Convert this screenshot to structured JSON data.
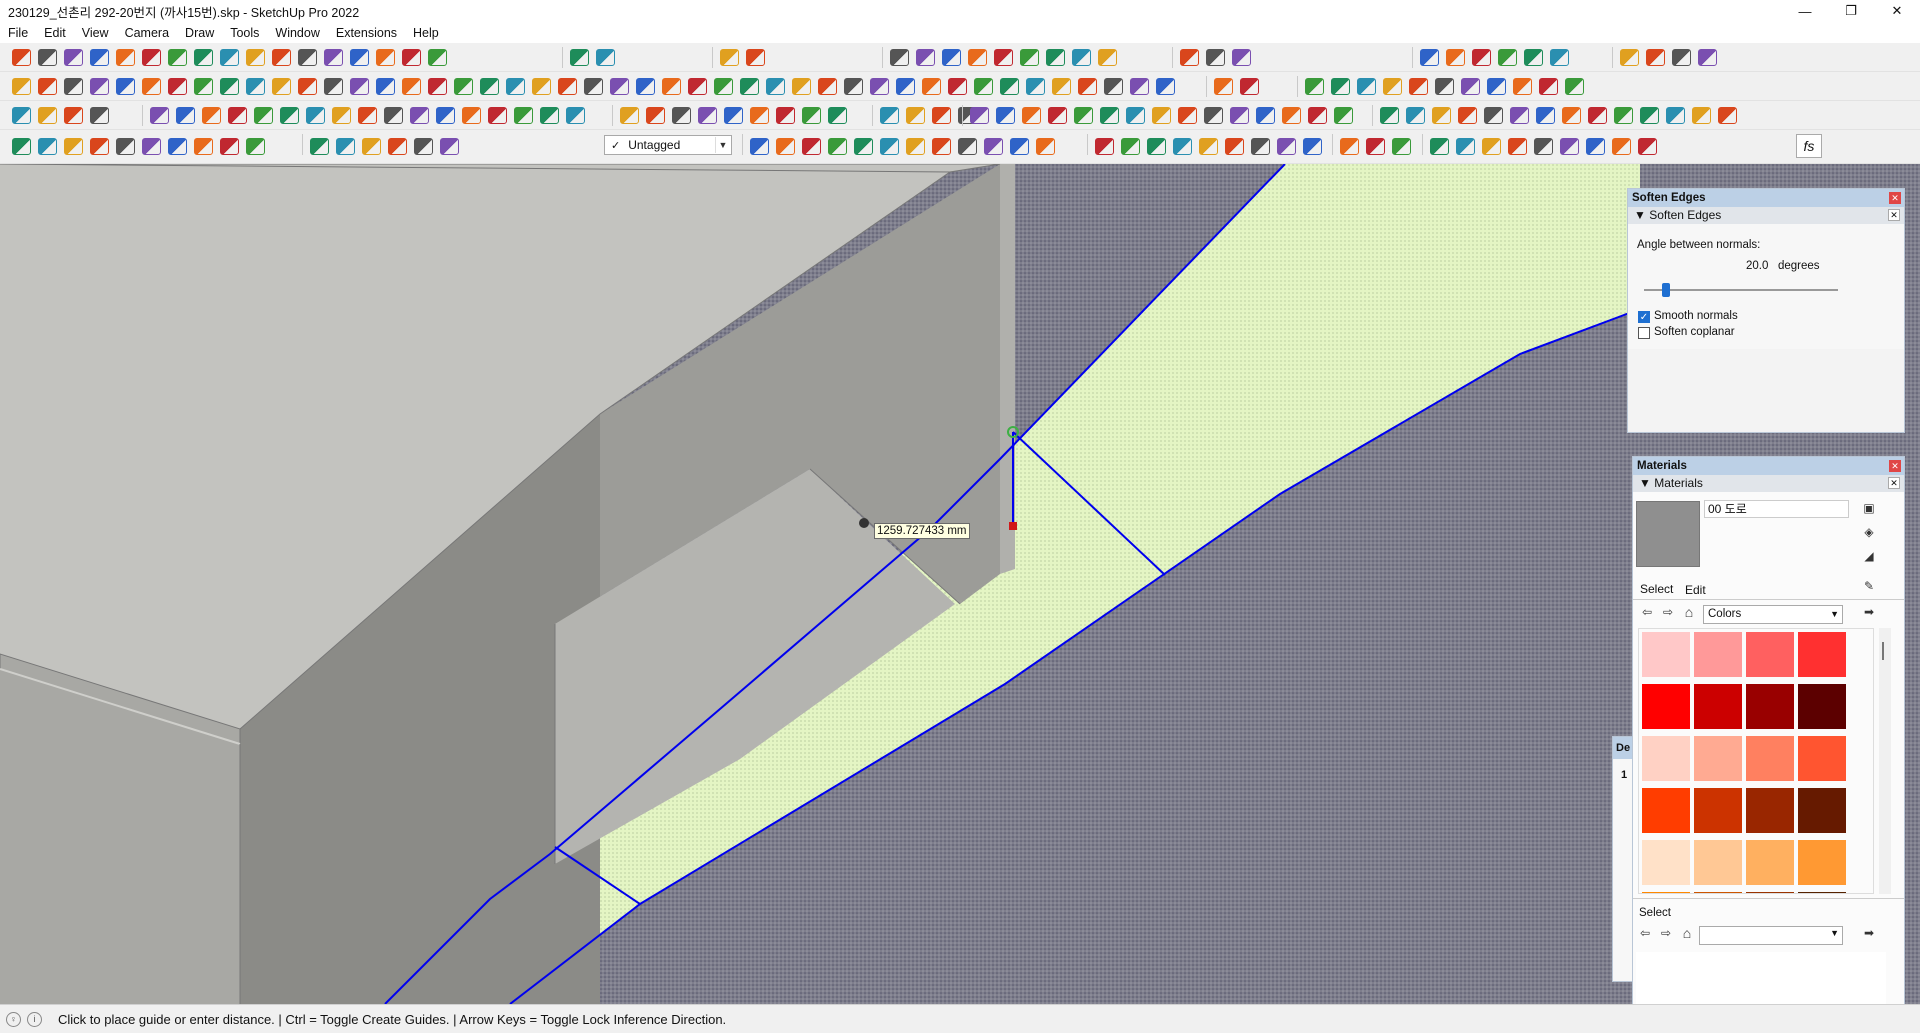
{
  "window": {
    "title": "230129_선촌리 292-20번지 (까사15번).skp - SketchUp Pro 2022",
    "minimize": "—",
    "maximize": "❐",
    "close": "✕"
  },
  "menu": [
    "File",
    "Edit",
    "View",
    "Camera",
    "Draw",
    "Tools",
    "Window",
    "Extensions",
    "Help"
  ],
  "toolbar": {
    "tag_selector": {
      "check": "✓",
      "value": "Untagged"
    },
    "fs_label": "fs"
  },
  "viewport": {
    "measurement_tooltip": "1259.727433 mm"
  },
  "soften_edges": {
    "tray_title": "Soften Edges",
    "panel_title": "Soften Edges",
    "angle_label": "Angle between normals:",
    "angle_value": "20.0",
    "angle_unit": "degrees",
    "slider_level_degrees": 20.0,
    "slider_max_degrees": 180,
    "smooth_normals": {
      "label": "Smooth normals",
      "checked": true
    },
    "soften_coplanar": {
      "label": "Soften coplanar",
      "checked": false
    }
  },
  "materials": {
    "tray_title": "Materials",
    "panel_title": "Materials",
    "current_name": "00 도로",
    "tabs": [
      "Select",
      "Edit"
    ],
    "library": "Colors",
    "swatches": [
      "#ffc8c8",
      "#ff9999",
      "#ff6060",
      "#ff3030",
      "#ff0000",
      "#cc0000",
      "#990000",
      "#5c0000",
      "#ffd1c4",
      "#ffaa92",
      "#ff8060",
      "#ff5530",
      "#ff3d00",
      "#cc3300",
      "#992600",
      "#661a00",
      "#ffe1c8",
      "#ffc895",
      "#ffb060",
      "#ff9933"
    ],
    "secondary_label": "Select",
    "hidden_tray_text": [
      "De",
      "1"
    ]
  },
  "statusbar": {
    "text": "Click to place guide or enter distance. | Ctrl = Toggle Create Guides. | Arrow Keys = Toggle Lock Inference Direction."
  },
  "colors": {
    "axis_blue": "#0000ee",
    "guide_green": "#3cb043",
    "ground_hatch": "#7a7a88",
    "road_fill": "#e4f5c4",
    "wall_light": "#c8c8c4",
    "wall_mid": "#a9a9a5",
    "wall_dark": "#8b8b87"
  }
}
